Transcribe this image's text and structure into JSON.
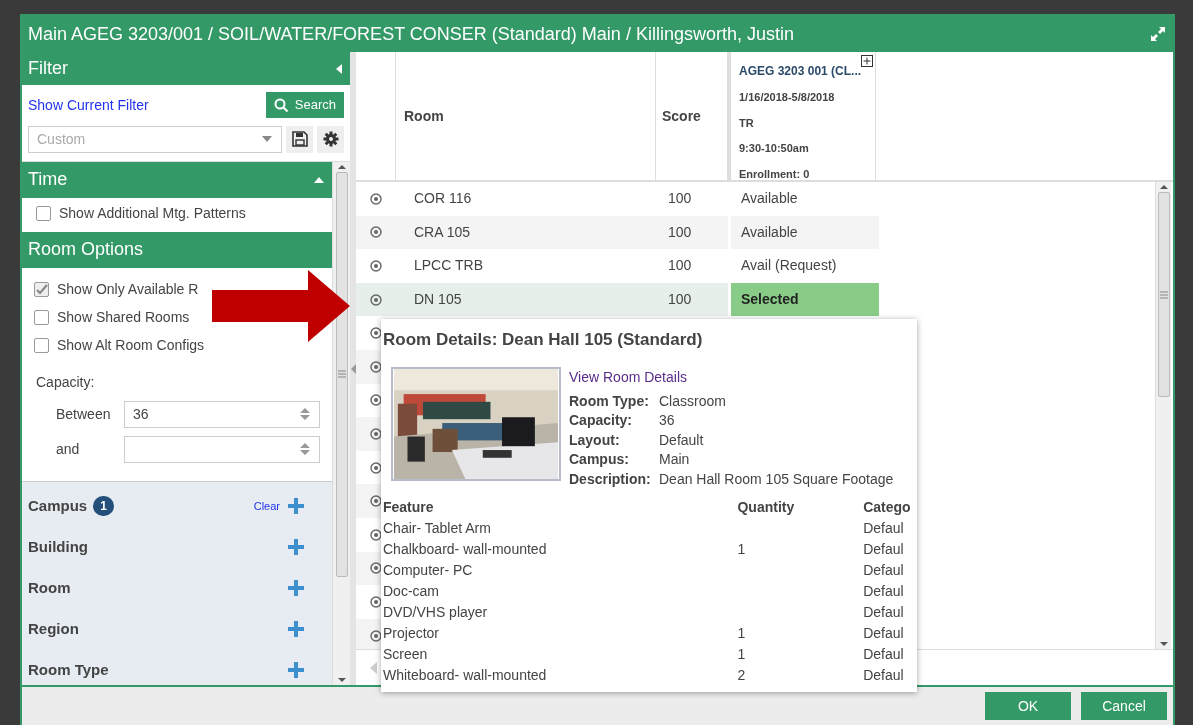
{
  "dialog": {
    "title": "Main AGEG 3203/001 / SOIL/WATER/FOREST CONSER (Standard) Main / Killingsworth, Justin"
  },
  "filter": {
    "title": "Filter",
    "show_filter_link": "Show Current Filter",
    "search_button": "Search",
    "saved_filter": {
      "placeholder": "Custom"
    }
  },
  "time": {
    "title": "Time",
    "options": [
      {
        "label": "Show Additional Mtg. Patterns",
        "checked": false
      }
    ]
  },
  "room_options": {
    "title": "Room Options",
    "options": [
      {
        "label": "Show Only Available R",
        "checked": true
      },
      {
        "label": "Show Shared Rooms",
        "checked": false
      },
      {
        "label": "Show Alt Room Configs",
        "checked": false
      }
    ],
    "capacity_label": "Capacity:",
    "between_label": "Between",
    "between_value": "36",
    "and_label": "and"
  },
  "criteria": [
    {
      "label": "Campus",
      "count": "1",
      "clear": "Clear"
    },
    {
      "label": "Building"
    },
    {
      "label": "Room"
    },
    {
      "label": "Region"
    },
    {
      "label": "Room Type"
    }
  ],
  "grid": {
    "columns": [
      "Room",
      "Score"
    ],
    "section_column": {
      "title": "AGEG 3203 001 (CL...",
      "dates": "1/16/2018-5/8/2018",
      "days": "TR",
      "time": "9:30-10:50am",
      "enrollment": "Enrollment: 0"
    },
    "rows": [
      {
        "room": "COR 116",
        "score": "100",
        "status": "Available",
        "selected": false
      },
      {
        "room": "CRA 105",
        "score": "100",
        "status": "Available",
        "selected": false
      },
      {
        "room": "LPCC TRB",
        "score": "100",
        "status": "Avail (Request)",
        "selected": false
      },
      {
        "room": "DN 105",
        "score": "100",
        "status": "Selected",
        "selected": true
      }
    ],
    "covered_rows": [
      {
        "selected": false
      },
      {
        "selected": false
      },
      {
        "selected": false
      },
      {
        "selected": false
      },
      {
        "selected": false
      },
      {
        "selected": false
      },
      {
        "selected": false
      },
      {
        "selected": false
      },
      {
        "selected": false
      },
      {
        "selected": false
      }
    ]
  },
  "room_details": {
    "title": "Room Details: Dean Hall 105 (Standard)",
    "link": "View Room Details",
    "fields": [
      {
        "label": "Room Type:",
        "value": "Classroom"
      },
      {
        "label": "Capacity:",
        "value": "36"
      },
      {
        "label": "Layout:",
        "value": "Default"
      },
      {
        "label": "Campus:",
        "value": "Main"
      },
      {
        "label": "Description:",
        "value": "Dean Hall Room 105 Square Footage"
      }
    ],
    "feature_columns": [
      "Feature",
      "Quantity",
      "Catego"
    ],
    "features": [
      {
        "feature": "Chair- Tablet Arm",
        "category": "Defaul"
      },
      {
        "feature": "Chalkboard- wall-mounted",
        "quantity": "1",
        "category": "Defaul"
      },
      {
        "feature": "Computer- PC",
        "category": "Defaul"
      },
      {
        "feature": "Doc-cam",
        "category": "Defaul"
      },
      {
        "feature": "DVD/VHS player",
        "category": "Defaul"
      },
      {
        "feature": "Projector",
        "quantity": "1",
        "category": "Defaul"
      },
      {
        "feature": "Screen",
        "quantity": "1",
        "category": "Defaul"
      },
      {
        "feature": "Whiteboard- wall-mounted",
        "quantity": "2",
        "category": "Defaul"
      }
    ]
  },
  "buttons": [
    {
      "label": "OK"
    },
    {
      "label": "Cancel"
    }
  ]
}
